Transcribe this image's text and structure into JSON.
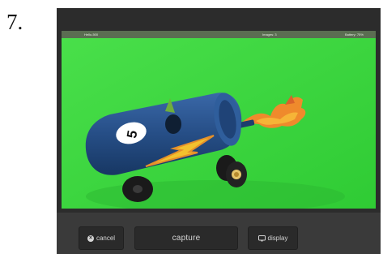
{
  "step_number": "7.",
  "status_bar": {
    "left": "Hello-500",
    "center": "Images: 3",
    "right": "Battery: 75%"
  },
  "controls": {
    "cancel_label": "cancel",
    "capture_label": "capture",
    "display_label": "display"
  },
  "photo": {
    "subject": "cardboard tube toy car",
    "car_number": "5"
  },
  "icons": {
    "cancel": "close-circle-icon",
    "display": "monitor-icon"
  },
  "colors": {
    "backdrop_green": "#3bd83c",
    "toolbar": "#3a3a3a",
    "car_blue": "#264e86",
    "bolt_yellow": "#f2c12e",
    "flame_orange": "#ef8a2c"
  }
}
